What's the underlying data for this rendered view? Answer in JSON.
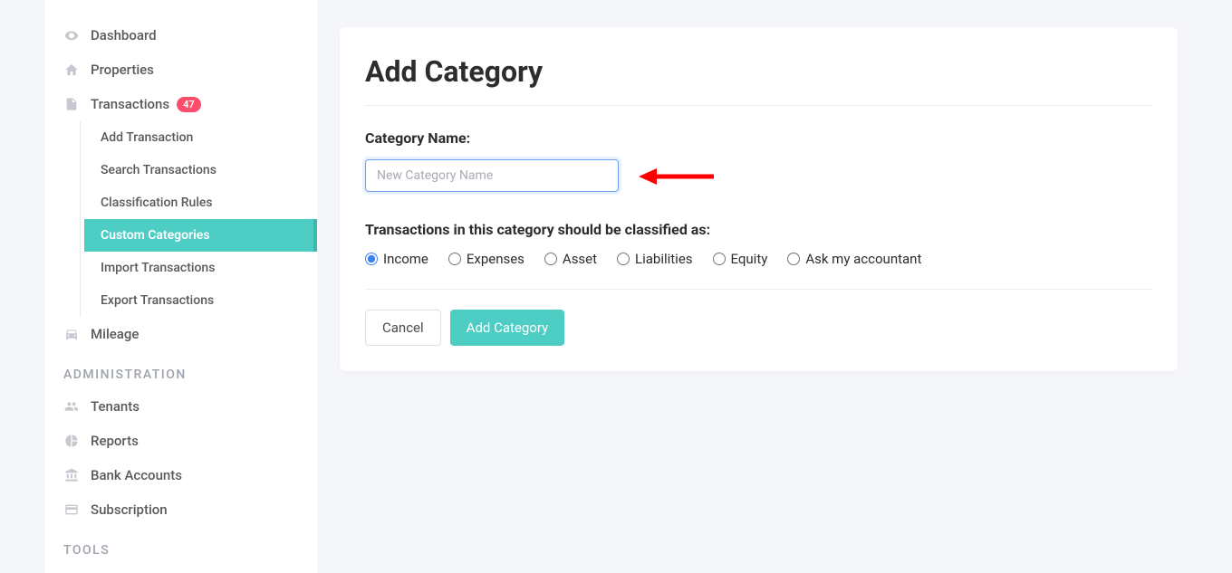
{
  "sidebar": {
    "nav": {
      "dashboard": "Dashboard",
      "properties": "Properties",
      "transactions": "Transactions",
      "transactions_badge": "47",
      "mileage": "Mileage"
    },
    "sub_transactions": {
      "add": "Add Transaction",
      "search": "Search Transactions",
      "rules": "Classification Rules",
      "custom": "Custom Categories",
      "import": "Import Transactions",
      "export": "Export Transactions"
    },
    "section_admin": "ADMINISTRATION",
    "admin": {
      "tenants": "Tenants",
      "reports": "Reports",
      "bank": "Bank Accounts",
      "subscription": "Subscription"
    },
    "section_tools": "TOOLS"
  },
  "main": {
    "title": "Add Category",
    "form": {
      "name_label": "Category Name:",
      "name_placeholder": "New Category Name",
      "classify_label": "Transactions in this category should be classified as:",
      "radios": {
        "income": "Income",
        "expenses": "Expenses",
        "asset": "Asset",
        "liabilities": "Liabilities",
        "equity": "Equity",
        "ask": "Ask my accountant"
      }
    },
    "buttons": {
      "cancel": "Cancel",
      "submit": "Add Category"
    }
  }
}
